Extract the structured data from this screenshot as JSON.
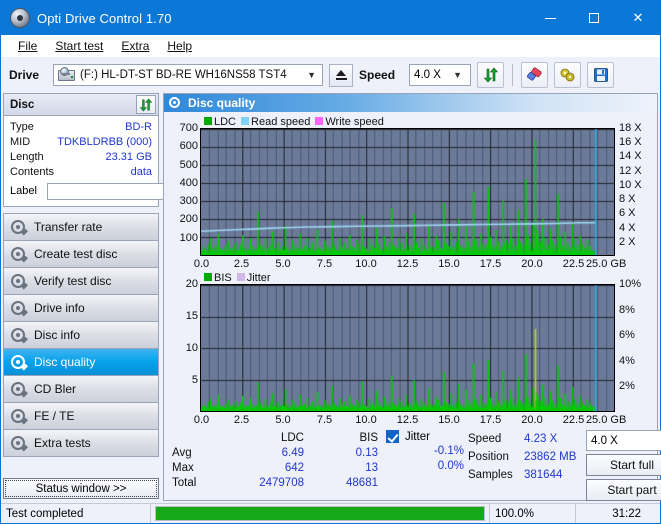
{
  "window": {
    "title": "Opti Drive Control 1.70",
    "minimize": "minimize-icon",
    "maximize": "maximize-icon",
    "close": "close-icon"
  },
  "menu": {
    "items": [
      "File",
      "Start test",
      "Extra",
      "Help"
    ]
  },
  "toolbar": {
    "drive_label": "Drive",
    "drive_value": "(F:)  HL-DT-ST BD-RE  WH16NS58 TST4",
    "eject": "eject-icon",
    "speed_label": "Speed",
    "speed_value": "4.0 X",
    "refresh": "refresh-icon",
    "erase": "eraser-icon",
    "key": "key-icon",
    "save": "save-icon"
  },
  "disc": {
    "header": "Disc",
    "refresh": "refresh-icon",
    "rows": [
      {
        "key": "Type",
        "value": "BD-R"
      },
      {
        "key": "MID",
        "value": "TDKBLDRBB (000)"
      },
      {
        "key": "Length",
        "value": "23.31 GB"
      },
      {
        "key": "Contents",
        "value": "data"
      }
    ],
    "label_key": "Label",
    "label_value": "",
    "label_placeholder": ""
  },
  "nav": {
    "items": [
      {
        "label": "Transfer rate",
        "selected": false
      },
      {
        "label": "Create test disc",
        "selected": false
      },
      {
        "label": "Verify test disc",
        "selected": false
      },
      {
        "label": "Drive info",
        "selected": false
      },
      {
        "label": "Disc info",
        "selected": false
      },
      {
        "label": "Disc quality",
        "selected": true
      },
      {
        "label": "CD Bler",
        "selected": false
      },
      {
        "label": "FE / TE",
        "selected": false
      },
      {
        "label": "Extra tests",
        "selected": false
      }
    ],
    "status_button": "Status window >>"
  },
  "panel": {
    "title": "Disc quality"
  },
  "stats": {
    "col_headers": [
      "LDC",
      "BIS"
    ],
    "jitter_label": "Jitter",
    "jitter_checked": true,
    "rows": [
      {
        "label": "Avg",
        "ldc": "6.49",
        "bis": "0.13",
        "jitter": "-0.1%"
      },
      {
        "label": "Max",
        "ldc": "642",
        "bis": "13",
        "jitter": "0.0%"
      },
      {
        "label": "Total",
        "ldc": "2479708",
        "bis": "48681",
        "jitter": ""
      }
    ]
  },
  "results": {
    "speed_label": "Speed",
    "speed_value": "4.23 X",
    "position_label": "Position",
    "position_value": "23862 MB",
    "samples_label": "Samples",
    "samples_value": "381644",
    "speed_select": "4.0 X",
    "start_full": "Start full",
    "start_part": "Start part"
  },
  "statusbar": {
    "text": "Test completed",
    "percent_label": "100.0%",
    "percent_value": 100,
    "time": "31:22"
  },
  "colors": {
    "accent": "#0b78d7",
    "plot_bg": "#6b7a99",
    "ldc": "#00cc00",
    "bis": "#00cc00",
    "read_speed": "#9fd8f5",
    "write_speed": "#ff66ff",
    "jitter": "#c9a8e0",
    "value_text": "#2038cf",
    "progress": "#17a81a",
    "marker": "#17b6e8"
  },
  "chart_data": [
    {
      "type": "bar",
      "title": "Disc quality - LDC",
      "xlabel": "GB",
      "ylabel": "LDC",
      "xlim": [
        0,
        25
      ],
      "ylim": [
        0,
        700
      ],
      "y2lim": [
        0,
        18
      ],
      "y2label": "X",
      "grid": true,
      "legend": [
        {
          "name": "LDC",
          "color": "#00cc00"
        },
        {
          "name": "Read speed",
          "color": "#9fd8f5"
        },
        {
          "name": "Write speed",
          "color": "#ff66ff"
        }
      ],
      "xticks": [
        "0.0",
        "2.5",
        "5.0",
        "7.5",
        "10.0",
        "12.5",
        "15.0",
        "17.5",
        "20.0",
        "22.5",
        "25.0 GB"
      ],
      "yticks": [
        100,
        200,
        300,
        400,
        500,
        600,
        700
      ],
      "y2ticks": [
        "2 X",
        "4 X",
        "6 X",
        "8 X",
        "10 X",
        "12 X",
        "14 X",
        "16 X",
        "18 X"
      ],
      "end_marker_x": 23.86,
      "series": [
        {
          "name": "LDC",
          "color": "#00cc00",
          "x": [
            0.1,
            0.25,
            0.4,
            0.55,
            0.7,
            0.85,
            1.0,
            1.15,
            1.3,
            1.45,
            1.6,
            1.75,
            1.9,
            2.05,
            2.2,
            2.35,
            2.5,
            2.65,
            2.8,
            2.95,
            3.1,
            3.25,
            3.4,
            3.55,
            3.7,
            3.85,
            4.0,
            4.15,
            4.3,
            4.45,
            4.6,
            4.75,
            4.9,
            5.05,
            5.2,
            5.35,
            5.5,
            5.65,
            5.8,
            5.95,
            6.1,
            6.25,
            6.4,
            6.55,
            6.7,
            6.85,
            7.0,
            7.15,
            7.3,
            7.45,
            7.6,
            7.75,
            7.9,
            8.05,
            8.2,
            8.35,
            8.5,
            8.65,
            8.8,
            8.95,
            9.1,
            9.25,
            9.4,
            9.55,
            9.7,
            9.85,
            10.0,
            10.15,
            10.3,
            10.45,
            10.6,
            10.75,
            10.9,
            11.05,
            11.2,
            11.35,
            11.5,
            11.65,
            11.8,
            11.95,
            12.1,
            12.25,
            12.4,
            12.55,
            12.7,
            12.85,
            13.0,
            13.15,
            13.3,
            13.45,
            13.6,
            13.75,
            13.9,
            14.05,
            14.2,
            14.35,
            14.5,
            14.65,
            14.8,
            14.95,
            15.1,
            15.25,
            15.4,
            15.55,
            15.7,
            15.85,
            16.0,
            16.15,
            16.3,
            16.45,
            16.6,
            16.75,
            16.9,
            17.05,
            17.2,
            17.35,
            17.5,
            17.65,
            17.8,
            17.95,
            18.1,
            18.25,
            18.4,
            18.55,
            18.7,
            18.85,
            19.0,
            19.15,
            19.3,
            19.45,
            19.6,
            19.75,
            19.9,
            20.05,
            20.2,
            20.35,
            20.5,
            20.65,
            20.8,
            20.95,
            21.1,
            21.25,
            21.4,
            21.55,
            21.7,
            21.85,
            22.0,
            22.15,
            22.3,
            22.45,
            22.6,
            22.75,
            22.9,
            23.05,
            23.2,
            23.35,
            23.5,
            23.65,
            23.8
          ],
          "values": [
            45,
            30,
            60,
            95,
            35,
            50,
            120,
            40,
            30,
            55,
            80,
            35,
            45,
            70,
            30,
            60,
            110,
            40,
            35,
            95,
            50,
            30,
            240,
            60,
            45,
            90,
            35,
            55,
            130,
            40,
            70,
            35,
            50,
            160,
            45,
            30,
            85,
            60,
            40,
            120,
            35,
            50,
            95,
            40,
            65,
            30,
            140,
            45,
            35,
            80,
            55,
            40,
            190,
            60,
            30,
            95,
            45,
            70,
            35,
            110,
            50,
            40,
            85,
            60,
            220,
            45,
            35,
            90,
            55,
            40,
            150,
            60,
            30,
            105,
            45,
            70,
            260,
            50,
            40,
            95,
            65,
            35,
            120,
            55,
            45,
            230,
            70,
            40,
            90,
            60,
            35,
            170,
            50,
            45,
            110,
            80,
            40,
            290,
            65,
            50,
            130,
            45,
            70,
            200,
            55,
            40,
            160,
            75,
            50,
            350,
            90,
            45,
            120,
            65,
            55,
            380,
            100,
            50,
            140,
            70,
            45,
            300,
            85,
            60,
            160,
            90,
            50,
            250,
            75,
            55,
            420,
            110,
            60,
            180,
            640,
            120,
            70,
            200,
            95,
            55,
            150,
            80,
            60,
            340,
            100,
            50,
            130,
            70,
            45,
            180,
            90,
            55,
            110,
            60,
            40,
            85,
            50
          ]
        },
        {
          "name": "Read speed",
          "color": "#9fd8f5",
          "unit": "X",
          "x": [
            0.0,
            1.0,
            2.0,
            3.0,
            4.0,
            5.0,
            6.5,
            8.0,
            9.5,
            11.0,
            12.5,
            14.0,
            15.5,
            17.0,
            18.5,
            20.0,
            21.5,
            23.0,
            23.86
          ],
          "values": [
            3.4,
            3.5,
            3.6,
            3.7,
            3.8,
            3.9,
            4.0,
            4.05,
            4.1,
            4.15,
            4.2,
            4.25,
            4.3,
            4.35,
            4.4,
            4.45,
            4.5,
            4.6,
            4.6
          ]
        }
      ]
    },
    {
      "type": "bar",
      "title": "Disc quality - BIS",
      "xlabel": "GB",
      "ylabel": "BIS",
      "xlim": [
        0,
        25
      ],
      "ylim": [
        0,
        20
      ],
      "y2lim": [
        0,
        10
      ],
      "y2label": "%",
      "grid": true,
      "legend": [
        {
          "name": "BIS",
          "color": "#00cc00"
        },
        {
          "name": "Jitter",
          "color": "#c9a8e0"
        }
      ],
      "xticks": [
        "0.0",
        "2.5",
        "5.0",
        "7.5",
        "10.0",
        "12.5",
        "15.0",
        "17.5",
        "20.0",
        "22.5",
        "25.0 GB"
      ],
      "yticks": [
        5,
        10,
        15,
        20
      ],
      "y2ticks": [
        "2%",
        "4%",
        "6%",
        "8%",
        "10%"
      ],
      "end_marker_x": 23.86,
      "series": [
        {
          "name": "BIS",
          "color": "#00cc00",
          "x": [
            0.1,
            0.25,
            0.4,
            0.55,
            0.7,
            0.85,
            1.0,
            1.15,
            1.3,
            1.45,
            1.6,
            1.75,
            1.9,
            2.05,
            2.2,
            2.35,
            2.5,
            2.65,
            2.8,
            2.95,
            3.1,
            3.25,
            3.4,
            3.55,
            3.7,
            3.85,
            4.0,
            4.15,
            4.3,
            4.45,
            4.6,
            4.75,
            4.9,
            5.05,
            5.2,
            5.35,
            5.5,
            5.65,
            5.8,
            5.95,
            6.1,
            6.25,
            6.4,
            6.55,
            6.7,
            6.85,
            7.0,
            7.15,
            7.3,
            7.45,
            7.6,
            7.75,
            7.9,
            8.05,
            8.2,
            8.35,
            8.5,
            8.65,
            8.8,
            8.95,
            9.1,
            9.25,
            9.4,
            9.55,
            9.7,
            9.85,
            10.0,
            10.15,
            10.3,
            10.45,
            10.6,
            10.75,
            10.9,
            11.05,
            11.2,
            11.35,
            11.5,
            11.65,
            11.8,
            11.95,
            12.1,
            12.25,
            12.4,
            12.55,
            12.7,
            12.85,
            13.0,
            13.15,
            13.3,
            13.45,
            13.6,
            13.75,
            13.9,
            14.05,
            14.2,
            14.35,
            14.5,
            14.65,
            14.8,
            14.95,
            15.1,
            15.25,
            15.4,
            15.55,
            15.7,
            15.85,
            16.0,
            16.15,
            16.3,
            16.45,
            16.6,
            16.75,
            16.9,
            17.05,
            17.2,
            17.35,
            17.5,
            17.65,
            17.8,
            17.95,
            18.1,
            18.25,
            18.4,
            18.55,
            18.7,
            18.85,
            19.0,
            19.15,
            19.3,
            19.45,
            19.6,
            19.75,
            19.9,
            20.05,
            20.2,
            20.35,
            20.5,
            20.65,
            20.8,
            20.95,
            21.1,
            21.25,
            21.4,
            21.55,
            21.7,
            21.85,
            22.0,
            22.15,
            22.3,
            22.45,
            22.6,
            22.75,
            22.9,
            23.05,
            23.2,
            23.35,
            23.5,
            23.65,
            23.8
          ],
          "values": [
            1.0,
            0.6,
            1.4,
            2.0,
            0.8,
            1.0,
            2.6,
            0.9,
            0.6,
            1.2,
            1.8,
            0.7,
            1.0,
            1.5,
            0.6,
            1.3,
            2.4,
            0.9,
            0.8,
            2.0,
            1.1,
            0.6,
            4.5,
            1.3,
            1.0,
            1.9,
            0.8,
            1.2,
            2.8,
            0.9,
            1.5,
            0.8,
            1.1,
            3.4,
            1.0,
            0.7,
            1.8,
            1.3,
            0.9,
            2.6,
            0.8,
            1.1,
            2.0,
            0.9,
            1.4,
            0.7,
            3.0,
            1.0,
            0.8,
            1.7,
            1.2,
            0.9,
            4.0,
            1.3,
            0.7,
            2.0,
            1.0,
            1.5,
            0.8,
            2.4,
            1.1,
            0.9,
            1.8,
            1.3,
            4.7,
            1.0,
            0.8,
            1.9,
            1.2,
            0.9,
            3.2,
            1.3,
            0.7,
            2.2,
            1.0,
            1.5,
            5.6,
            1.1,
            0.9,
            2.0,
            1.4,
            0.8,
            2.6,
            1.2,
            1.0,
            4.9,
            1.5,
            0.9,
            1.9,
            1.3,
            0.8,
            3.6,
            1.1,
            1.0,
            2.3,
            1.7,
            0.9,
            6.2,
            1.4,
            1.1,
            2.8,
            1.0,
            1.5,
            4.3,
            1.2,
            0.9,
            3.4,
            1.6,
            1.1,
            7.5,
            1.9,
            1.0,
            2.6,
            1.4,
            1.2,
            8.1,
            2.1,
            1.1,
            3.0,
            1.5,
            1.0,
            6.4,
            1.8,
            1.3,
            3.4,
            1.9,
            1.1,
            5.3,
            1.6,
            1.2,
            9.0,
            2.3,
            1.3,
            3.8,
            13.0,
            2.5,
            1.5,
            4.2,
            2.0,
            1.2,
            3.2,
            1.7,
            1.3,
            7.2,
            2.1,
            1.1,
            2.8,
            1.5,
            1.0,
            3.8,
            1.9,
            1.2,
            2.4,
            1.3,
            0.9,
            1.8,
            1.1
          ]
        }
      ]
    }
  ]
}
